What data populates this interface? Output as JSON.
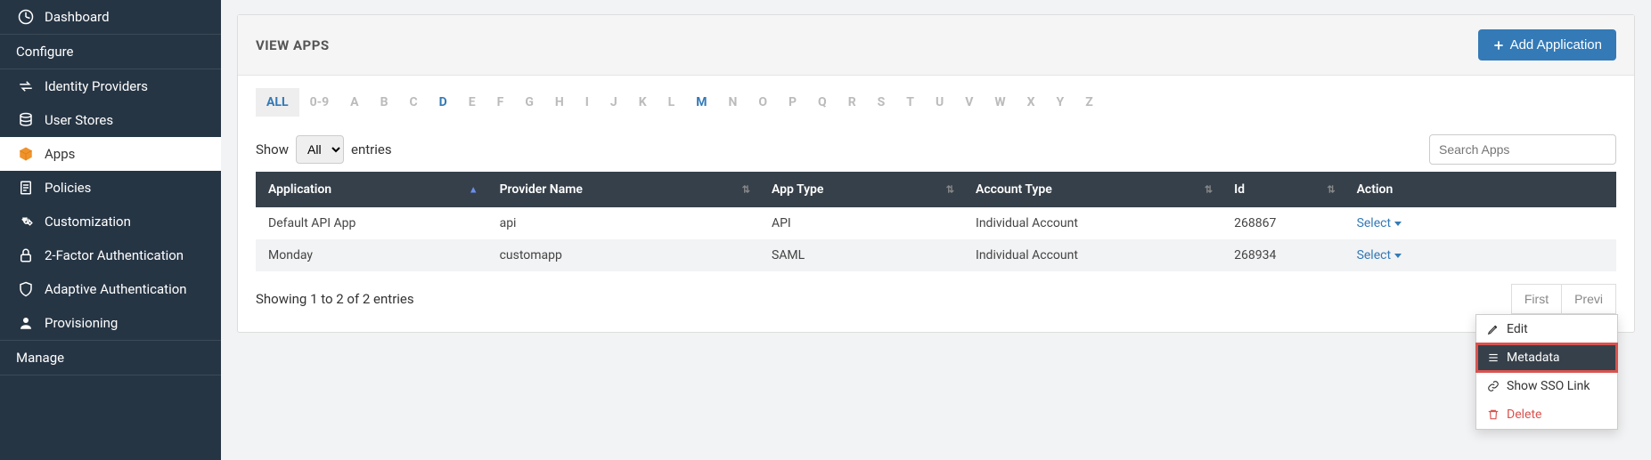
{
  "sidebar": {
    "items": [
      {
        "label": "Dashboard"
      }
    ],
    "section_configure": "Configure",
    "configure_items": [
      {
        "label": "Identity Providers"
      },
      {
        "label": "User Stores"
      },
      {
        "label": "Apps"
      },
      {
        "label": "Policies"
      },
      {
        "label": "Customization"
      },
      {
        "label": "2-Factor Authentication"
      },
      {
        "label": "Adaptive Authentication"
      },
      {
        "label": "Provisioning"
      }
    ],
    "section_manage": "Manage"
  },
  "header": {
    "title": "VIEW APPS",
    "add_button": "Add Application"
  },
  "alpha": {
    "all": "ALL",
    "items": [
      "0-9",
      "A",
      "B",
      "C",
      "D",
      "E",
      "F",
      "G",
      "H",
      "I",
      "J",
      "K",
      "L",
      "M",
      "N",
      "O",
      "P",
      "Q",
      "R",
      "S",
      "T",
      "U",
      "V",
      "W",
      "X",
      "Y",
      "Z"
    ],
    "active": "ALL",
    "highlights": [
      "D",
      "M"
    ]
  },
  "table_controls": {
    "show_label": "Show",
    "show_value": "All",
    "entries_label": "entries",
    "search_placeholder": "Search Apps"
  },
  "table": {
    "columns": {
      "application": "Application",
      "provider": "Provider Name",
      "app_type": "App Type",
      "account_type": "Account Type",
      "id": "Id",
      "action": "Action"
    },
    "rows": [
      {
        "application": "Default API App",
        "provider": "api",
        "app_type": "API",
        "account_type": "Individual Account",
        "id": "268867",
        "action": "Select"
      },
      {
        "application": "Monday",
        "provider": "customapp",
        "app_type": "SAML",
        "account_type": "Individual Account",
        "id": "268934",
        "action": "Select"
      }
    ]
  },
  "footer": {
    "showing": "Showing 1 to 2 of 2 entries",
    "first": "First",
    "previous": "Previ"
  },
  "dropdown": {
    "edit": "Edit",
    "metadata": "Metadata",
    "show_sso": "Show SSO Link",
    "delete": "Delete"
  }
}
